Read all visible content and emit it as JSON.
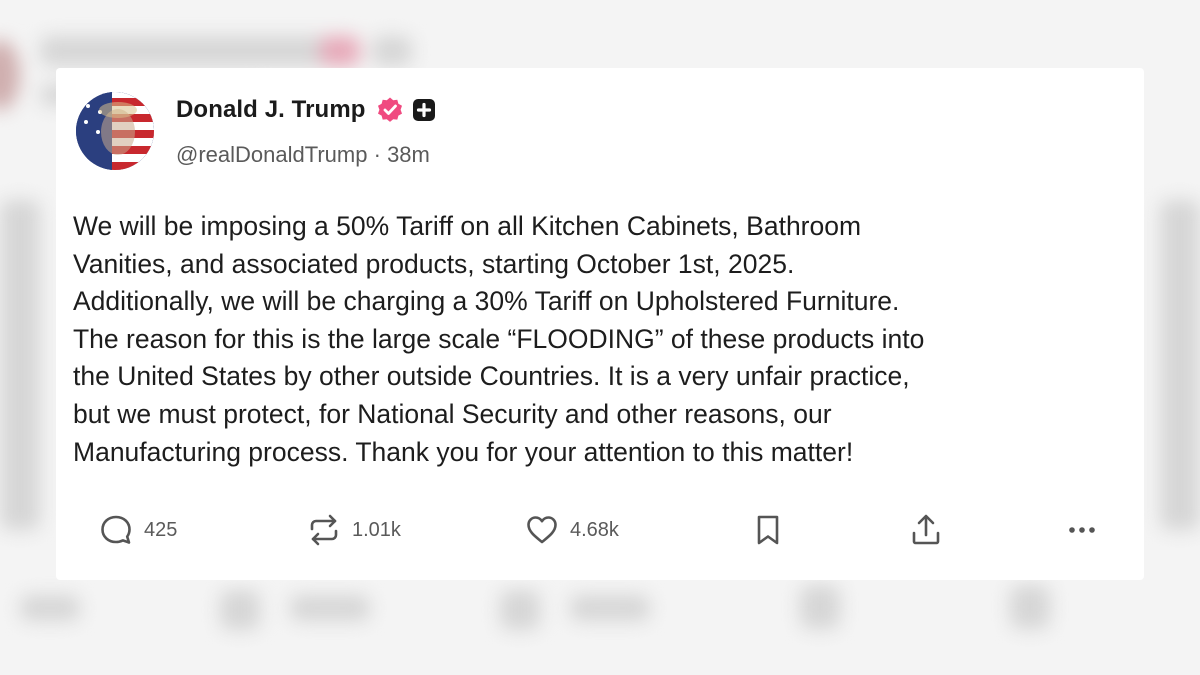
{
  "post": {
    "author_name": "Donald J. Trump",
    "handle": "@realDonaldTrump",
    "separator": "·",
    "time_ago": "38m",
    "text": "We will be imposing a 50% Tariff on all Kitchen Cabinets, Bathroom\nVanities, and associated products, starting October 1st, 2025.\nAdditionally, we will be charging a 30% Tariff on Upholstered Furniture.\nThe reason for this is the large scale “FLOODING” of these products into\nthe United States by other outside Countries. It is a very unfair practice,\nbut we must protect, for National Security and other reasons, our\nManufacturing process. Thank you for your attention to this matter!"
  },
  "actions": {
    "replies": "425",
    "reposts": "1.01k",
    "likes": "4.68k"
  },
  "icons": {
    "verified": "verified-badge-icon",
    "plus": "plus-badge-icon",
    "reply": "reply-icon",
    "repost": "repost-icon",
    "like": "heart-icon",
    "bookmark": "bookmark-icon",
    "share": "share-icon",
    "more": "more-icon"
  },
  "colors": {
    "verified_badge": "#f04a80",
    "card_background": "#ffffff",
    "page_background": "#f4f4f4",
    "secondary_text": "#5a5a5a"
  }
}
